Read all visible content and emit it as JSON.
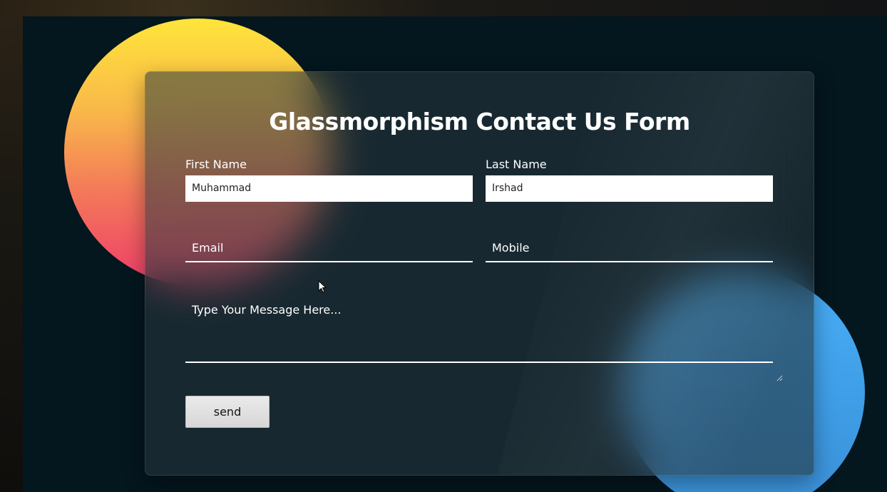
{
  "form": {
    "title": "Glassmorphism Contact Us Form",
    "first_name": {
      "label": "First Name",
      "value": "Muhammad"
    },
    "last_name": {
      "label": "Last Name",
      "value": "Irshad"
    },
    "email": {
      "placeholder": "Email"
    },
    "mobile": {
      "placeholder": "Mobile"
    },
    "message": {
      "placeholder": "Type Your Message Here..."
    },
    "send_label": "send"
  },
  "colors": {
    "background": "#04161e",
    "orange_circle_top": "#ffe53a",
    "orange_circle_bottom": "#ef3d6a",
    "blue_circle": "#49aef5",
    "button": "#dcdcdc"
  },
  "icons": [
    "mouse-cursor-icon",
    "resize-grip-icon"
  ]
}
